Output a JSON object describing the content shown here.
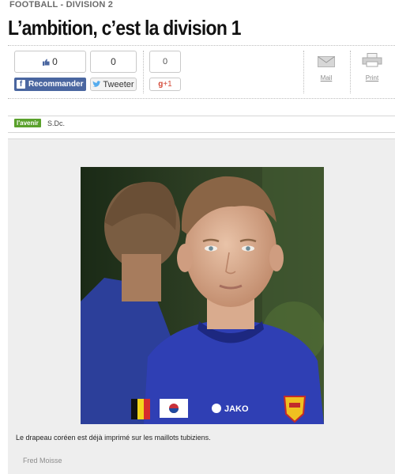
{
  "article": {
    "kicker": "FOOTBALL - DIVISION 2",
    "title": "L’ambition, c’est la division 1"
  },
  "share": {
    "facebook": {
      "count": "0",
      "label": "Recommander"
    },
    "twitter": {
      "count": "0",
      "label": "Tweeter"
    },
    "gplus": {
      "count": "0",
      "label": "+1"
    },
    "mail_label": "Mail",
    "print_label": "Print"
  },
  "byline": {
    "source": "l'avenir",
    "author": "S.Dc."
  },
  "photo": {
    "caption": "Le drapeau coréen est déjà imprimé sur les maillots tubiziens.",
    "credit": "Fred Moisse",
    "shirt_brand": "JAKO"
  },
  "colors": {
    "facebook": "#4a66a0",
    "source_green": "#5aa12c",
    "gplus": "#d34836",
    "jersey": "#2f3fb4"
  }
}
